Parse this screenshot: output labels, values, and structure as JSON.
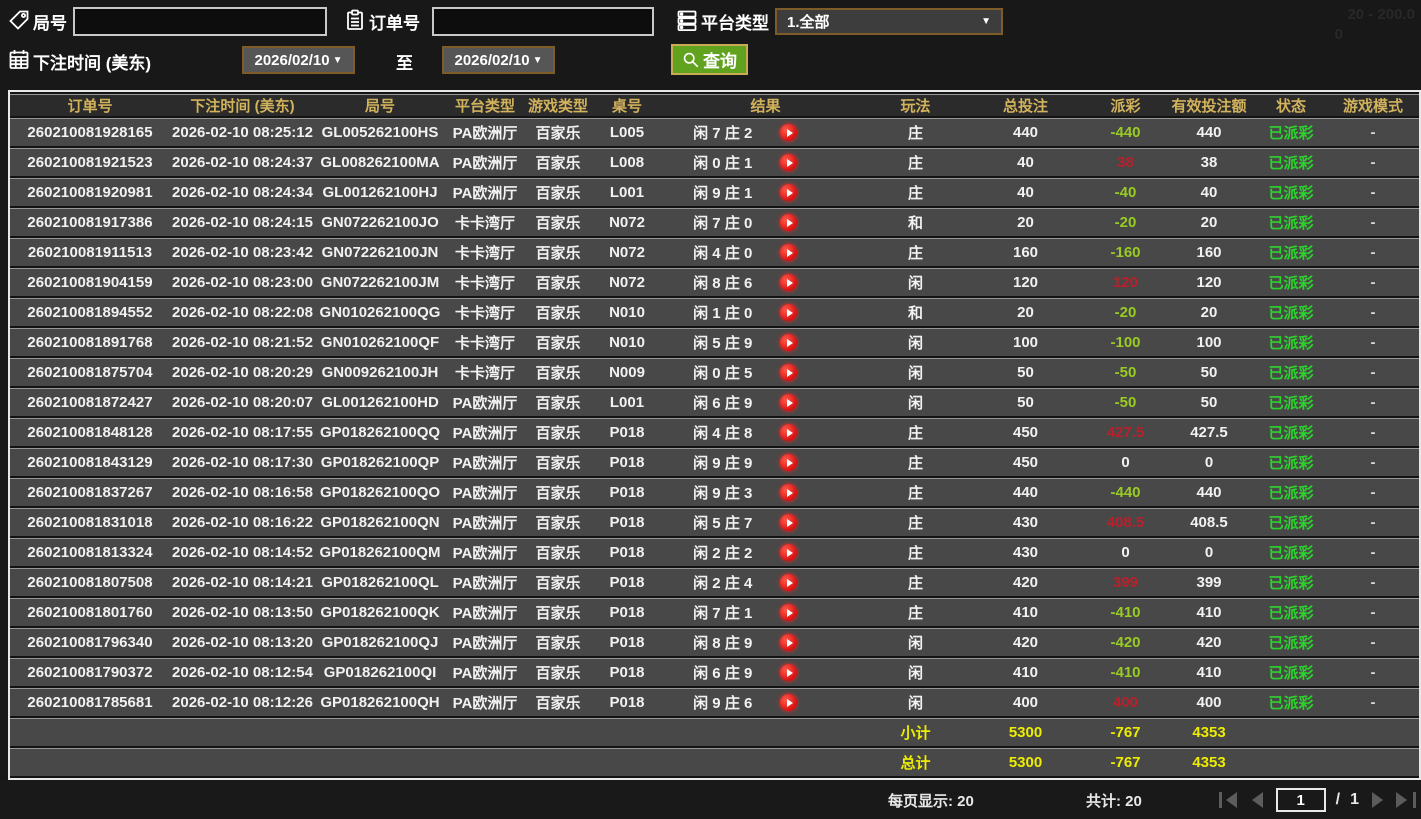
{
  "filters": {
    "game_no_label": "局号",
    "order_no_label": "订单号",
    "platform_label": "平台类型",
    "platform_value": "1.全部",
    "bet_time_label": "下注时间 (美东)",
    "date_from": "2026/02/10",
    "date_to": "2026/02/10",
    "to_label": "至",
    "search_label": "查询"
  },
  "watermark": {
    "line1": "20 - 200.0",
    "line2": "0"
  },
  "table": {
    "headers": [
      "订单号",
      "下注时间 (美东)",
      "局号",
      "平台类型",
      "游戏类型",
      "桌号",
      "结果",
      "玩法",
      "总投注",
      "派彩",
      "有效投注额",
      "状态",
      "游戏模式"
    ],
    "rows": [
      {
        "order": "260210081928165",
        "time": "2026-02-10 08:25:12",
        "game_no": "GL005262100HS",
        "platform": "PA欧洲厅",
        "game_type": "百家乐",
        "table_no": "L005",
        "result": "闲 7 庄 2",
        "play": "庄",
        "bet": "440",
        "payout": "-440",
        "payout_cls": "neg",
        "valid": "440",
        "status": "已派彩",
        "mode": "-"
      },
      {
        "order": "260210081921523",
        "time": "2026-02-10 08:24:37",
        "game_no": "GL008262100MA",
        "platform": "PA欧洲厅",
        "game_type": "百家乐",
        "table_no": "L008",
        "result": "闲 0 庄 1",
        "play": "庄",
        "bet": "40",
        "payout": "38",
        "payout_cls": "pos",
        "valid": "38",
        "status": "已派彩",
        "mode": "-"
      },
      {
        "order": "260210081920981",
        "time": "2026-02-10 08:24:34",
        "game_no": "GL001262100HJ",
        "platform": "PA欧洲厅",
        "game_type": "百家乐",
        "table_no": "L001",
        "result": "闲 9 庄 1",
        "play": "庄",
        "bet": "40",
        "payout": "-40",
        "payout_cls": "neg",
        "valid": "40",
        "status": "已派彩",
        "mode": "-"
      },
      {
        "order": "260210081917386",
        "time": "2026-02-10 08:24:15",
        "game_no": "GN072262100JO",
        "platform": "卡卡湾厅",
        "game_type": "百家乐",
        "table_no": "N072",
        "result": "闲 7 庄 0",
        "play": "和",
        "bet": "20",
        "payout": "-20",
        "payout_cls": "neg",
        "valid": "20",
        "status": "已派彩",
        "mode": "-"
      },
      {
        "order": "260210081911513",
        "time": "2026-02-10 08:23:42",
        "game_no": "GN072262100JN",
        "platform": "卡卡湾厅",
        "game_type": "百家乐",
        "table_no": "N072",
        "result": "闲 4 庄 0",
        "play": "庄",
        "bet": "160",
        "payout": "-160",
        "payout_cls": "neg",
        "valid": "160",
        "status": "已派彩",
        "mode": "-"
      },
      {
        "order": "260210081904159",
        "time": "2026-02-10 08:23:00",
        "game_no": "GN072262100JM",
        "platform": "卡卡湾厅",
        "game_type": "百家乐",
        "table_no": "N072",
        "result": "闲 8 庄 6",
        "play": "闲",
        "bet": "120",
        "payout": "120",
        "payout_cls": "pos",
        "valid": "120",
        "status": "已派彩",
        "mode": "-"
      },
      {
        "order": "260210081894552",
        "time": "2026-02-10 08:22:08",
        "game_no": "GN010262100QG",
        "platform": "卡卡湾厅",
        "game_type": "百家乐",
        "table_no": "N010",
        "result": "闲 1 庄 0",
        "play": "和",
        "bet": "20",
        "payout": "-20",
        "payout_cls": "neg",
        "valid": "20",
        "status": "已派彩",
        "mode": "-"
      },
      {
        "order": "260210081891768",
        "time": "2026-02-10 08:21:52",
        "game_no": "GN010262100QF",
        "platform": "卡卡湾厅",
        "game_type": "百家乐",
        "table_no": "N010",
        "result": "闲 5 庄 9",
        "play": "闲",
        "bet": "100",
        "payout": "-100",
        "payout_cls": "neg",
        "valid": "100",
        "status": "已派彩",
        "mode": "-"
      },
      {
        "order": "260210081875704",
        "time": "2026-02-10 08:20:29",
        "game_no": "GN009262100JH",
        "platform": "卡卡湾厅",
        "game_type": "百家乐",
        "table_no": "N009",
        "result": "闲 0 庄 5",
        "play": "闲",
        "bet": "50",
        "payout": "-50",
        "payout_cls": "neg",
        "valid": "50",
        "status": "已派彩",
        "mode": "-"
      },
      {
        "order": "260210081872427",
        "time": "2026-02-10 08:20:07",
        "game_no": "GL001262100HD",
        "platform": "PA欧洲厅",
        "game_type": "百家乐",
        "table_no": "L001",
        "result": "闲 6 庄 9",
        "play": "闲",
        "bet": "50",
        "payout": "-50",
        "payout_cls": "neg",
        "valid": "50",
        "status": "已派彩",
        "mode": "-"
      },
      {
        "order": "260210081848128",
        "time": "2026-02-10 08:17:55",
        "game_no": "GP018262100QQ",
        "platform": "PA欧洲厅",
        "game_type": "百家乐",
        "table_no": "P018",
        "result": "闲 4 庄 8",
        "play": "庄",
        "bet": "450",
        "payout": "427.5",
        "payout_cls": "pos",
        "valid": "427.5",
        "status": "已派彩",
        "mode": "-"
      },
      {
        "order": "260210081843129",
        "time": "2026-02-10 08:17:30",
        "game_no": "GP018262100QP",
        "platform": "PA欧洲厅",
        "game_type": "百家乐",
        "table_no": "P018",
        "result": "闲 9 庄 9",
        "play": "庄",
        "bet": "450",
        "payout": "0",
        "payout_cls": "zero",
        "valid": "0",
        "status": "已派彩",
        "mode": "-"
      },
      {
        "order": "260210081837267",
        "time": "2026-02-10 08:16:58",
        "game_no": "GP018262100QO",
        "platform": "PA欧洲厅",
        "game_type": "百家乐",
        "table_no": "P018",
        "result": "闲 9 庄 3",
        "play": "庄",
        "bet": "440",
        "payout": "-440",
        "payout_cls": "neg",
        "valid": "440",
        "status": "已派彩",
        "mode": "-"
      },
      {
        "order": "260210081831018",
        "time": "2026-02-10 08:16:22",
        "game_no": "GP018262100QN",
        "platform": "PA欧洲厅",
        "game_type": "百家乐",
        "table_no": "P018",
        "result": "闲 5 庄 7",
        "play": "庄",
        "bet": "430",
        "payout": "408.5",
        "payout_cls": "pos",
        "valid": "408.5",
        "status": "已派彩",
        "mode": "-"
      },
      {
        "order": "260210081813324",
        "time": "2026-02-10 08:14:52",
        "game_no": "GP018262100QM",
        "platform": "PA欧洲厅",
        "game_type": "百家乐",
        "table_no": "P018",
        "result": "闲 2 庄 2",
        "play": "庄",
        "bet": "430",
        "payout": "0",
        "payout_cls": "zero",
        "valid": "0",
        "status": "已派彩",
        "mode": "-"
      },
      {
        "order": "260210081807508",
        "time": "2026-02-10 08:14:21",
        "game_no": "GP018262100QL",
        "platform": "PA欧洲厅",
        "game_type": "百家乐",
        "table_no": "P018",
        "result": "闲 2 庄 4",
        "play": "庄",
        "bet": "420",
        "payout": "399",
        "payout_cls": "pos",
        "valid": "399",
        "status": "已派彩",
        "mode": "-"
      },
      {
        "order": "260210081801760",
        "time": "2026-02-10 08:13:50",
        "game_no": "GP018262100QK",
        "platform": "PA欧洲厅",
        "game_type": "百家乐",
        "table_no": "P018",
        "result": "闲 7 庄 1",
        "play": "庄",
        "bet": "410",
        "payout": "-410",
        "payout_cls": "neg",
        "valid": "410",
        "status": "已派彩",
        "mode": "-"
      },
      {
        "order": "260210081796340",
        "time": "2026-02-10 08:13:20",
        "game_no": "GP018262100QJ",
        "platform": "PA欧洲厅",
        "game_type": "百家乐",
        "table_no": "P018",
        "result": "闲 8 庄 9",
        "play": "闲",
        "bet": "420",
        "payout": "-420",
        "payout_cls": "neg",
        "valid": "420",
        "status": "已派彩",
        "mode": "-"
      },
      {
        "order": "260210081790372",
        "time": "2026-02-10 08:12:54",
        "game_no": "GP018262100QI",
        "platform": "PA欧洲厅",
        "game_type": "百家乐",
        "table_no": "P018",
        "result": "闲 6 庄 9",
        "play": "闲",
        "bet": "410",
        "payout": "-410",
        "payout_cls": "neg",
        "valid": "410",
        "status": "已派彩",
        "mode": "-"
      },
      {
        "order": "260210081785681",
        "time": "2026-02-10 08:12:26",
        "game_no": "GP018262100QH",
        "platform": "PA欧洲厅",
        "game_type": "百家乐",
        "table_no": "P018",
        "result": "闲 9 庄 6",
        "play": "闲",
        "bet": "400",
        "payout": "400",
        "payout_cls": "pos",
        "valid": "400",
        "status": "已派彩",
        "mode": "-"
      }
    ],
    "subtotal": {
      "label": "小计",
      "bet": "5300",
      "payout": "-767",
      "valid": "4353"
    },
    "total": {
      "label": "总计",
      "bet": "5300",
      "payout": "-767",
      "valid": "4353"
    }
  },
  "footer": {
    "per_page": "每页显示: 20",
    "total_count": "共计: 20",
    "page": "1",
    "page_sep": "/",
    "total_pages": "1"
  }
}
